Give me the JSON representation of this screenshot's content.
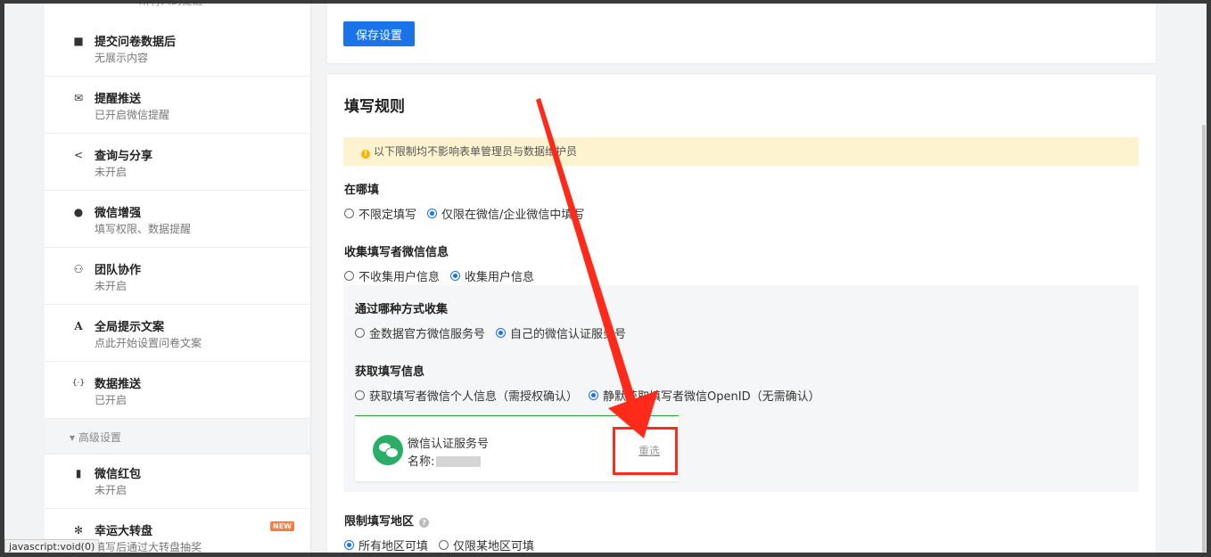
{
  "sidebar": {
    "top_cut_text": "所有人的提醒",
    "items": [
      {
        "title": "提交问卷数据后",
        "sub": "无展示内容",
        "icon": "square-icon"
      },
      {
        "title": "提醒推送",
        "sub": "已开启微信提醒",
        "icon": "envelope-icon"
      },
      {
        "title": "查询与分享",
        "sub": "未开启",
        "icon": "share-icon"
      },
      {
        "title": "微信增强",
        "sub": "填写权限、数据提醒",
        "icon": "wechat-icon"
      },
      {
        "title": "团队协作",
        "sub": "未开启",
        "icon": "users-icon"
      },
      {
        "title": "全局提示文案",
        "sub": "点此开始设置问卷文案",
        "icon": "font-icon"
      },
      {
        "title": "数据推送",
        "sub": "已开启",
        "icon": "code-icon"
      }
    ],
    "section_label": "高级设置",
    "advanced_items": [
      {
        "title": "微信红包",
        "sub": "未开启",
        "icon": "redpacket-icon"
      },
      {
        "title": "幸运大转盘",
        "sub": "填写后通过大转盘抽奖",
        "icon": "wheel-icon",
        "badge": "NEW"
      }
    ]
  },
  "status_bar": "javascript:void(0)",
  "toolbar": {
    "save_label": "保存设置"
  },
  "rules": {
    "title": "填写规则",
    "notice": "以下限制均不影响表单管理员与数据维护员",
    "where": {
      "label": "在哪填",
      "options": [
        "不限定填写",
        "仅限在微信/企业微信中填写"
      ],
      "selected_index": 1
    },
    "collect": {
      "label": "收集填写者微信信息",
      "options": [
        "不收集用户信息",
        "收集用户信息"
      ],
      "selected_index": 1
    },
    "method": {
      "label": "通过哪种方式收集",
      "options": [
        "金数据官方微信服务号",
        "自己的微信认证服务号"
      ],
      "selected_index": 1
    },
    "info": {
      "label": "获取填写信息",
      "options": [
        "获取填写者微信个人信息（需授权确认）",
        "静默获取填写者微信OpenID（无需确认）"
      ],
      "selected_index": 1
    },
    "wechat_account": {
      "title": "微信认证服务号",
      "name_label": "名称:",
      "reselect": "重选"
    },
    "region": {
      "label": "限制填写地区",
      "options": [
        "所有地区可填",
        "仅限某地区可填"
      ],
      "selected_index": 0
    }
  },
  "colors": {
    "accent": "#1a73e8",
    "highlight": "#ff2a1a",
    "notice_bg": "#fdf4cf",
    "wechat_green": "#2aae67"
  }
}
